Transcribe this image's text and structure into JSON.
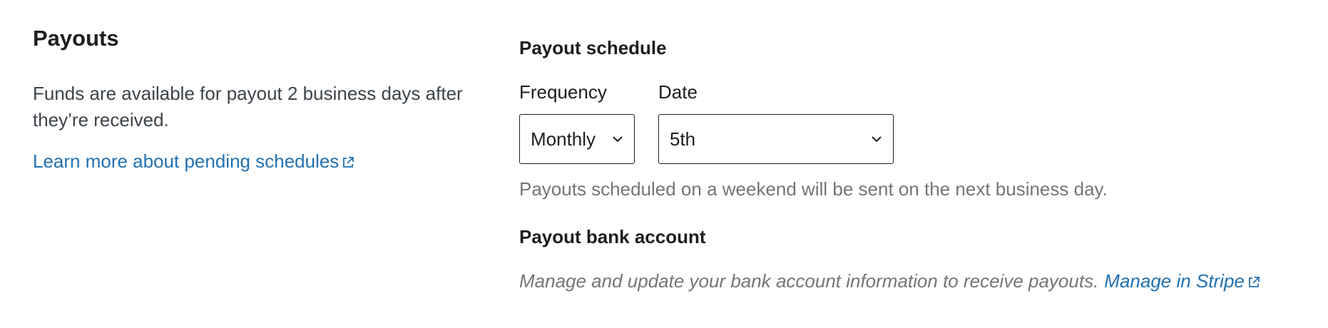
{
  "payouts": {
    "title": "Payouts",
    "description": "Funds are available for payout 2 business days after they’re received.",
    "learn_more_link": "Learn more about pending schedules"
  },
  "schedule": {
    "heading": "Payout schedule",
    "frequency_label": "Frequency",
    "frequency_value": "Monthly",
    "date_label": "Date",
    "date_value": "5th",
    "help_text": "Payouts scheduled on a weekend will be sent on the next business day."
  },
  "bank_account": {
    "heading": "Payout bank account",
    "description": "Manage and update your bank account information to receive payouts.",
    "manage_link": "Manage in Stripe"
  },
  "icons": {
    "external_link": "external-link-icon",
    "dropdown": "chevron-down-icon"
  },
  "colors": {
    "link": "#2271b1",
    "text": "#1e1e1e",
    "muted": "#757575",
    "description": "#3c434a"
  }
}
